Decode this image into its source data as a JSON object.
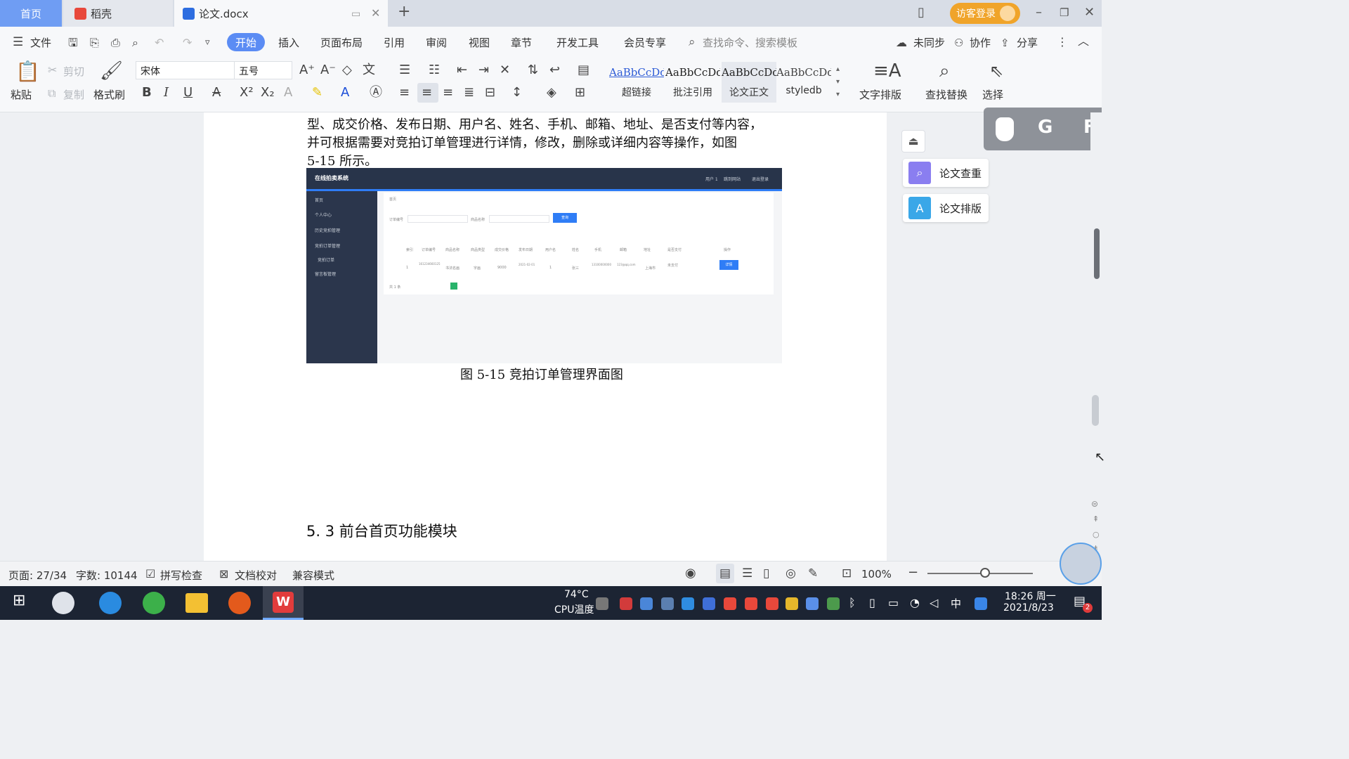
{
  "tabs": {
    "home": "首页",
    "daoke": "稻壳",
    "document": "论文.docx"
  },
  "titlebar": {
    "login": "访客登录"
  },
  "menu": {
    "file": "文件",
    "items": [
      "开始",
      "插入",
      "页面布局",
      "引用",
      "审阅",
      "视图",
      "章节",
      "开发工具",
      "会员专享"
    ],
    "search_placeholder": "查找命令、搜索模板",
    "sync": "未同步",
    "collab": "协作",
    "share": "分享"
  },
  "toolbar": {
    "paste": "粘贴",
    "cut": "剪切",
    "copy": "复制",
    "format_painter": "格式刷",
    "font_name": "宋体",
    "font_size": "五号",
    "styles": [
      {
        "sample": "AaBbCcDd",
        "name": "超链接",
        "color": "#2d5bd6"
      },
      {
        "sample": "AaBbCcDd",
        "name": "批注引用",
        "color": "#222222"
      },
      {
        "sample": "AaBbCcDd",
        "name": "论文正文",
        "color": "#222222"
      },
      {
        "sample": "AaBbCcDd",
        "name": "styledb",
        "color": "#444444"
      }
    ],
    "text_layout": "文字排版",
    "find_replace": "查找替换",
    "select": "选择"
  },
  "document": {
    "line1": "型、成交价格、发布日期、用户名、姓名、手机、邮箱、地址、是否支付等内容，",
    "line2": "并可根据需要对竞拍订单管理进行详情，修改，删除或详细内容等操作，如图",
    "line3": "5-15 所示。",
    "caption": "图 5-15 竞拍订单管理界面图",
    "heading": "5. 3 前台首页功能模块"
  },
  "embedded_screenshot": {
    "title": "在线拍卖系统",
    "top_links": [
      "用户 1",
      "跳到网站",
      "退出登录"
    ],
    "sidebar": [
      "首页",
      "个人中心",
      "历史竞拍管理",
      "竞拍订单管理",
      "竞拍订单",
      "留言板管理"
    ],
    "breadcrumb": "首页",
    "filter1": "订单编号",
    "filter2": "商品名称",
    "search_btn": "查询",
    "columns": [
      "索引",
      "订单编号",
      "商品名称",
      "商品类型",
      "成交价格",
      "发布日期",
      "用户名",
      "姓名",
      "手机",
      "邮箱",
      "地址",
      "是否支付",
      "操作"
    ],
    "row": [
      "1",
      "161234660125",
      "书法名画",
      "字画",
      "9000",
      "2021-02-01",
      "1",
      "张三",
      "13100000000",
      "123@qq.com",
      "上海市",
      "未支付",
      "详情"
    ],
    "pagination": "共 1 条"
  },
  "side_panel": {
    "check": "论文查重",
    "layout": "论文排版",
    "float_letters": [
      "G",
      "F"
    ]
  },
  "status": {
    "page": "页面: 27/34",
    "words": "字数: 10144",
    "spell": "拼写检查",
    "proof": "文档校对",
    "compat": "兼容模式",
    "zoom": "100%"
  },
  "taskbar": {
    "cpu_temp": "74°C",
    "cpu_label": "CPU温度",
    "ime": "中",
    "time": "18:26 周一",
    "date": "2021/8/23",
    "notify_count": "2"
  }
}
